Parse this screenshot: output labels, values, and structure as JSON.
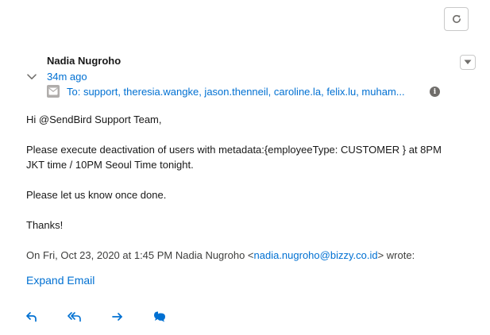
{
  "toolbar": {
    "refresh_icon": "refresh-icon"
  },
  "email": {
    "sender": "Nadia Nugroho",
    "time_ago": "34m ago",
    "to_line": "To: support, theresia.wangke, jason.thenneil, caroline.la, felix.lu, muham...",
    "info_glyph": "i",
    "body": {
      "greeting": "Hi @SendBird Support Team,",
      "para1_line1": "Please execute deactivation of users with metadata:{employeeType: CUSTOMER } at 8PM",
      "para1_line2": "JKT time  /  10PM Seoul Time tonight.",
      "para2": "Please let us know once done.",
      "closing": "Thanks!"
    },
    "quote": {
      "prefix": "On Fri, Oct 23, 2020 at 1:45 PM Nadia Nugroho <",
      "email": "nadia.nugroho@bizzy.co.id",
      "suffix": "> wrote:"
    },
    "expand_label": "Expand Email"
  },
  "actions": [
    "reply-icon",
    "reply-all-icon",
    "forward-icon",
    "chat-icon"
  ],
  "colors": {
    "link": "#0070d2",
    "text": "#181818",
    "icon_gray": "#706e6b",
    "border": "#c9c9c9"
  }
}
